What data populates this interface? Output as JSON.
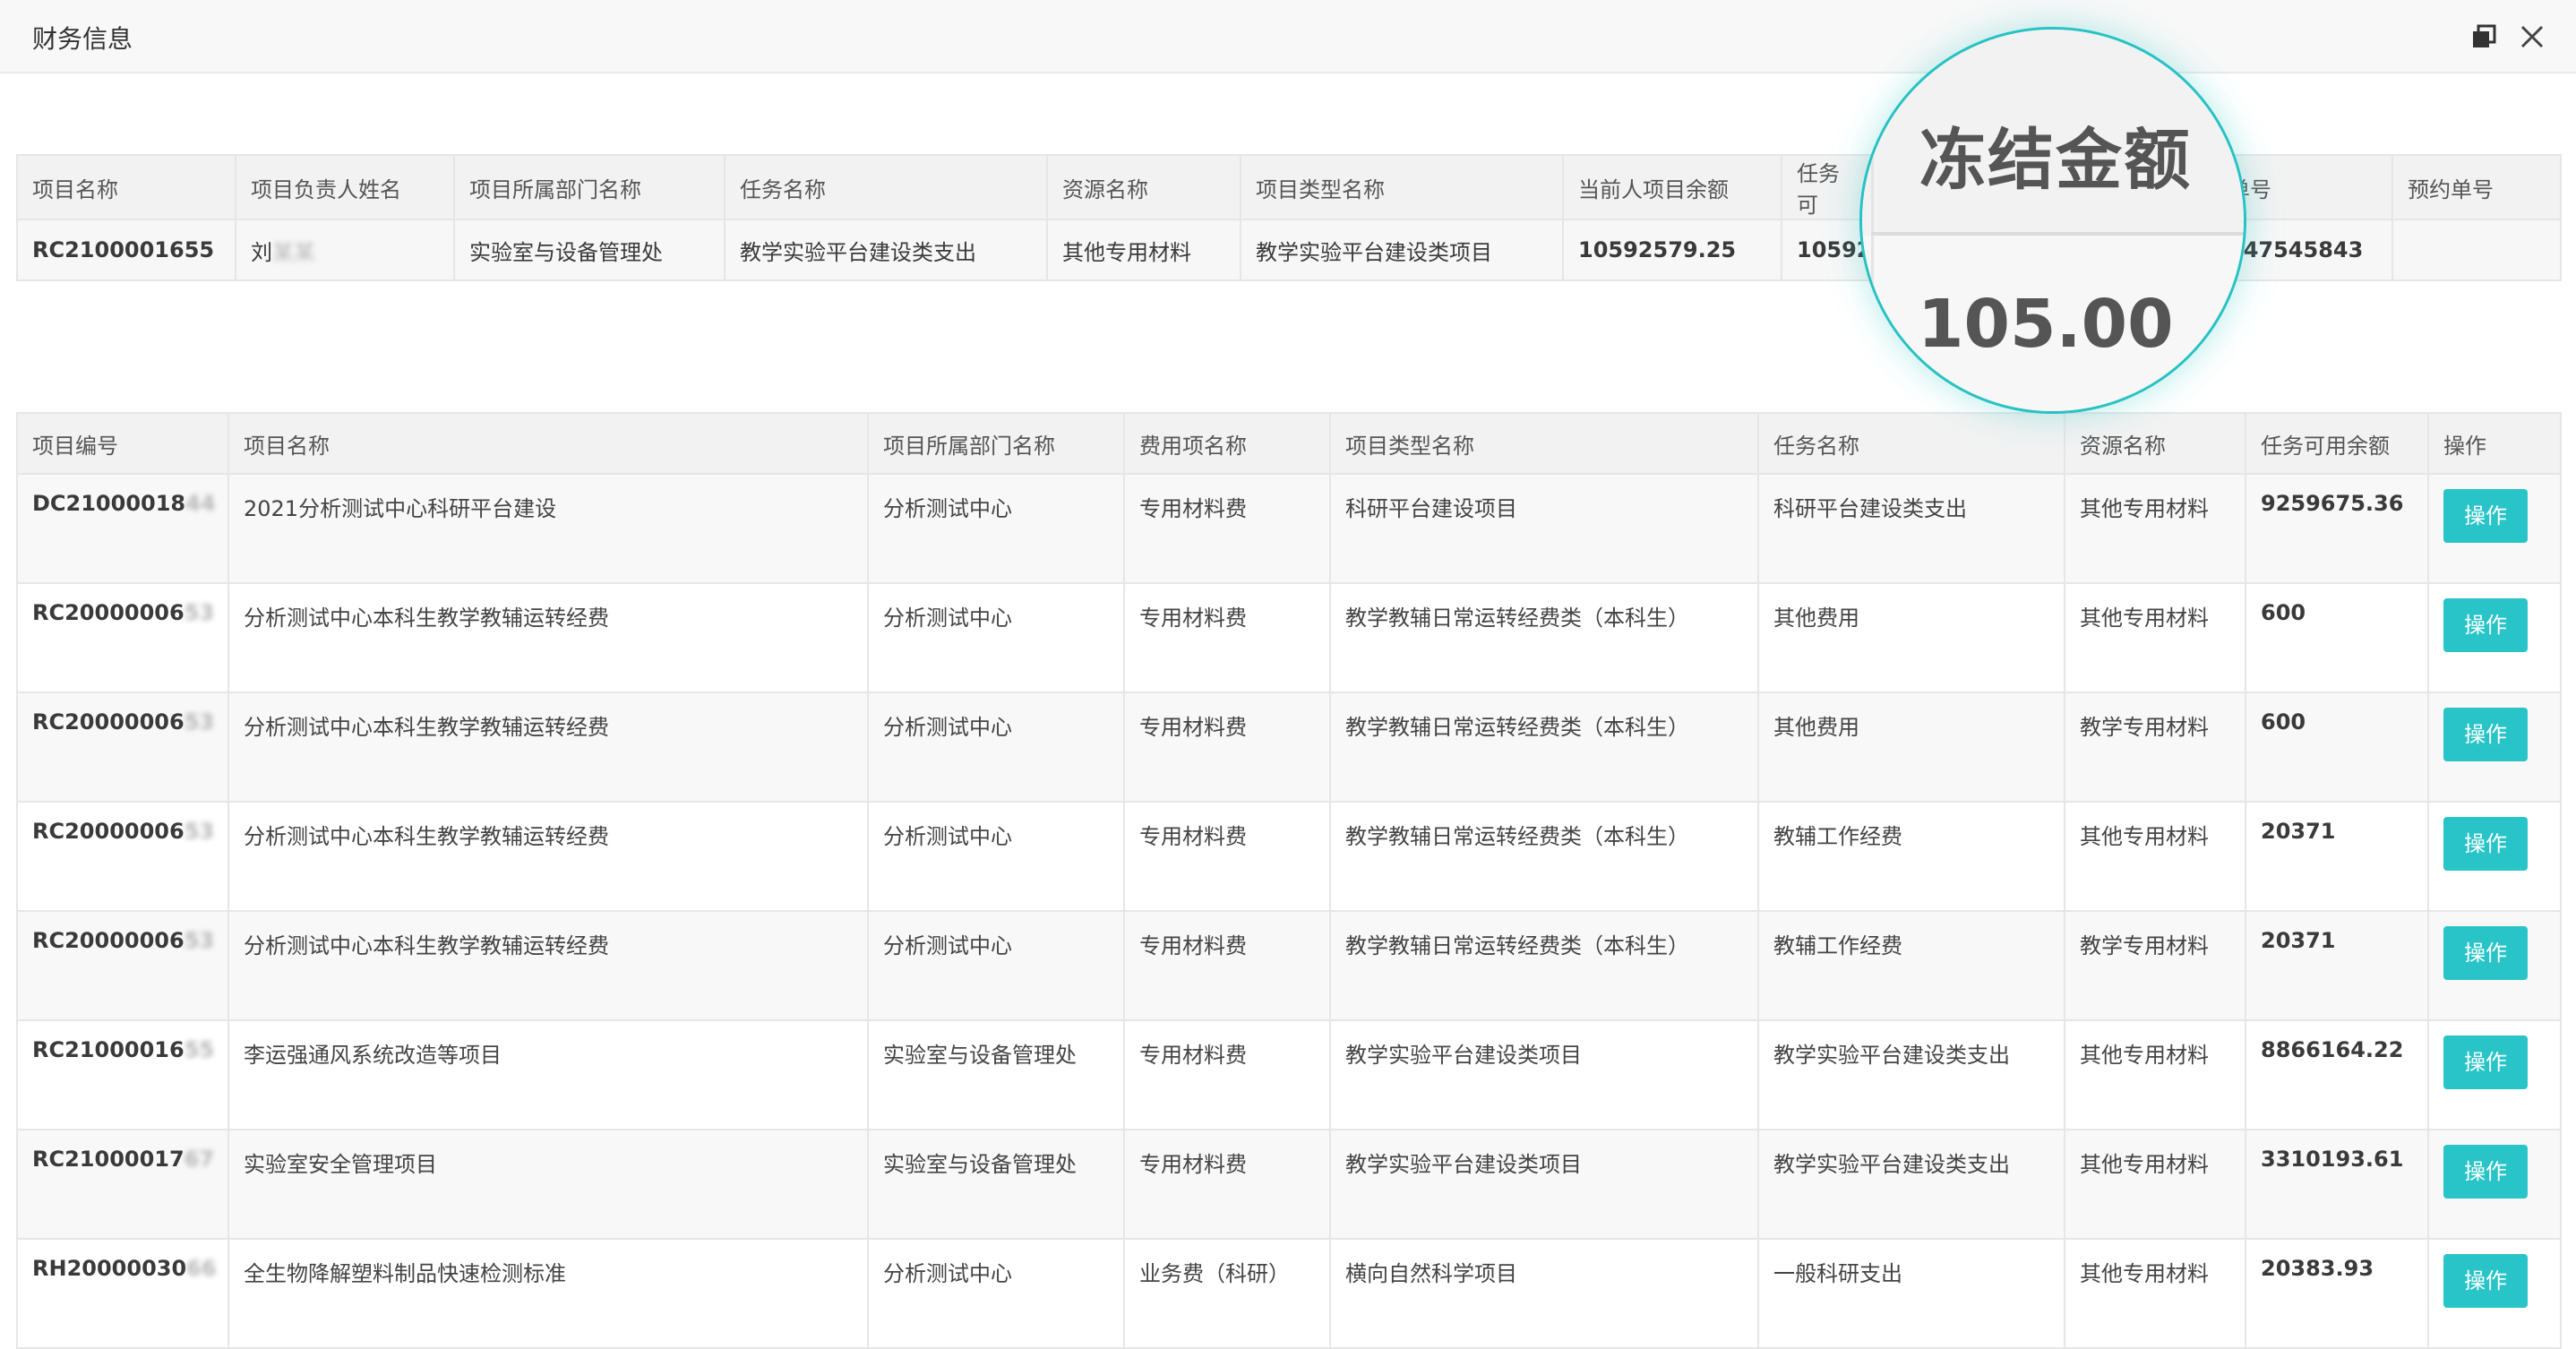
{
  "window": {
    "title": "财务信息"
  },
  "top_table": {
    "headers": [
      "项目名称",
      "项目负责人姓名",
      "项目所属部门名称",
      "任务名称",
      "资源名称",
      "项目类型名称",
      "当前人项目余额",
      "任务可",
      "",
      "单号",
      "预约单号"
    ],
    "row": [
      "RC2100001655",
      "刘",
      "实验室与设备管理处",
      "教学实验平台建设类支出",
      "其他专用材料",
      "教学实验平台建设类项目",
      "10592579.25",
      "105925",
      "",
      "547545843",
      ""
    ],
    "row_blur_suffix": "某某"
  },
  "magnifier": {
    "header": "冻结金额",
    "value": "105.00"
  },
  "main_table": {
    "headers": [
      "项目编号",
      "项目名称",
      "项目所属部门名称",
      "费用项名称",
      "项目类型名称",
      "任务名称",
      "资源名称",
      "任务可用余额",
      "操作"
    ],
    "rows": [
      {
        "code": "DC21000018",
        "code_blur": "44",
        "name": "2021分析测试中心科研平台建设",
        "dept": "分析测试中心",
        "fee": "专用材料费",
        "type": "科研平台建设项目",
        "task": "科研平台建设类支出",
        "resource": "其他专用材料",
        "balance": "9259675.36",
        "op": "操作"
      },
      {
        "code": "RC20000006",
        "code_blur": "53",
        "name": "分析测试中心本科生教学教辅运转经费",
        "dept": "分析测试中心",
        "fee": "专用材料费",
        "type": "教学教辅日常运转经费类（本科生）",
        "task": "其他费用",
        "resource": "其他专用材料",
        "balance": "600",
        "op": "操作"
      },
      {
        "code": "RC20000006",
        "code_blur": "53",
        "name": "分析测试中心本科生教学教辅运转经费",
        "dept": "分析测试中心",
        "fee": "专用材料费",
        "type": "教学教辅日常运转经费类（本科生）",
        "task": "其他费用",
        "resource": "教学专用材料",
        "balance": "600",
        "op": "操作"
      },
      {
        "code": "RC20000006",
        "code_blur": "53",
        "name": "分析测试中心本科生教学教辅运转经费",
        "dept": "分析测试中心",
        "fee": "专用材料费",
        "type": "教学教辅日常运转经费类（本科生）",
        "task": "教辅工作经费",
        "resource": "其他专用材料",
        "balance": "20371",
        "op": "操作"
      },
      {
        "code": "RC20000006",
        "code_blur": "53",
        "name": "分析测试中心本科生教学教辅运转经费",
        "dept": "分析测试中心",
        "fee": "专用材料费",
        "type": "教学教辅日常运转经费类（本科生）",
        "task": "教辅工作经费",
        "resource": "教学专用材料",
        "balance": "20371",
        "op": "操作"
      },
      {
        "code": "RC21000016",
        "code_blur": "55",
        "name": "李运强通风系统改造等项目",
        "dept": "实验室与设备管理处",
        "fee": "专用材料费",
        "type": "教学实验平台建设类项目",
        "task": "教学实验平台建设类支出",
        "resource": "其他专用材料",
        "balance": "8866164.22",
        "op": "操作"
      },
      {
        "code": "RC21000017",
        "code_blur": "67",
        "name": "实验室安全管理项目",
        "dept": "实验室与设备管理处",
        "fee": "专用材料费",
        "type": "教学实验平台建设类项目",
        "task": "教学实验平台建设类支出",
        "resource": "其他专用材料",
        "balance": "3310193.61",
        "op": "操作"
      },
      {
        "code": "RH20000030",
        "code_blur": "66",
        "name": "全生物降解塑料制品快速检测标准",
        "dept": "分析测试中心",
        "fee": "业务费（科研）",
        "type": "横向自然科学项目",
        "task": "一般科研支出",
        "resource": "其他专用材料",
        "balance": "20383.93",
        "op": "操作"
      }
    ]
  },
  "colors": {
    "accent": "#29c4c8",
    "header_bg": "#f2f2f2",
    "border": "#e6e6e6"
  },
  "icons": {
    "restore": "restore-icon",
    "close": "close-icon"
  }
}
